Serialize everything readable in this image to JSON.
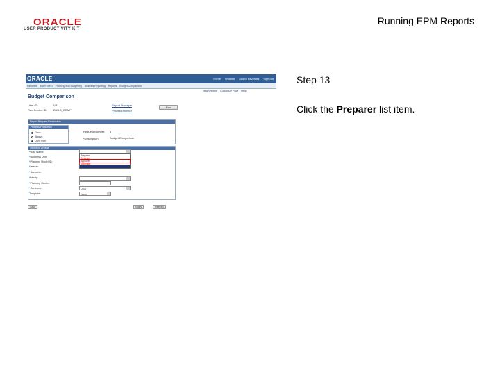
{
  "header": {
    "logo_name": "ORACLE",
    "logo_sub": "USER PRODUCTIVITY KIT",
    "document_title": "Running EPM Reports"
  },
  "step": {
    "label": "Step 13",
    "instruction_prefix": "Click the ",
    "instruction_bold": "Preparer",
    "instruction_suffix": " list item."
  },
  "screenshot": {
    "brand": "ORACLE",
    "top_links": [
      "Home",
      "Worklist",
      "Add to Favorites",
      "Sign out"
    ],
    "nav_items": [
      "Favorites",
      "Main Menu",
      "Planning and Budgeting",
      "Analysis Reporting",
      "Reports",
      "Budget Comparison"
    ],
    "util_links": [
      "New Window",
      "Customize Page",
      "Help"
    ],
    "page_heading": "Budget Comparison",
    "user_id_label": "User ID:",
    "user_id_value": "VP1",
    "run_control_label": "Run Control ID:",
    "run_control_value": "BUDG_COMP",
    "report_manager": "Report Manager",
    "process_monitor": "Process Monitor",
    "run_label": "Run",
    "report_request_head": "Report Request Parameters",
    "process_frequency_head": "Process Frequency",
    "freq_options": [
      "Once",
      "Always",
      "Don't Run"
    ],
    "report_number_label": "Request Number:",
    "report_number_value": "1",
    "description_label": "*Description:",
    "description_value": "Budget Comparison",
    "selection_head": "Selection Criteria",
    "field_labels": [
      "*Role Name:",
      "*Business Unit:",
      "*Planning Model ID:",
      "Version:",
      "*Scenario:",
      "Activity:",
      "*Planning Center:",
      "*Currency:",
      "Template:"
    ],
    "dropdown_items": [
      "Preparer",
      "Reviewer",
      "Approver",
      "Submitter"
    ],
    "currency_value": "USD",
    "template_value": "None",
    "bottom_buttons": [
      "Save",
      "Notify",
      "Refresh"
    ]
  }
}
